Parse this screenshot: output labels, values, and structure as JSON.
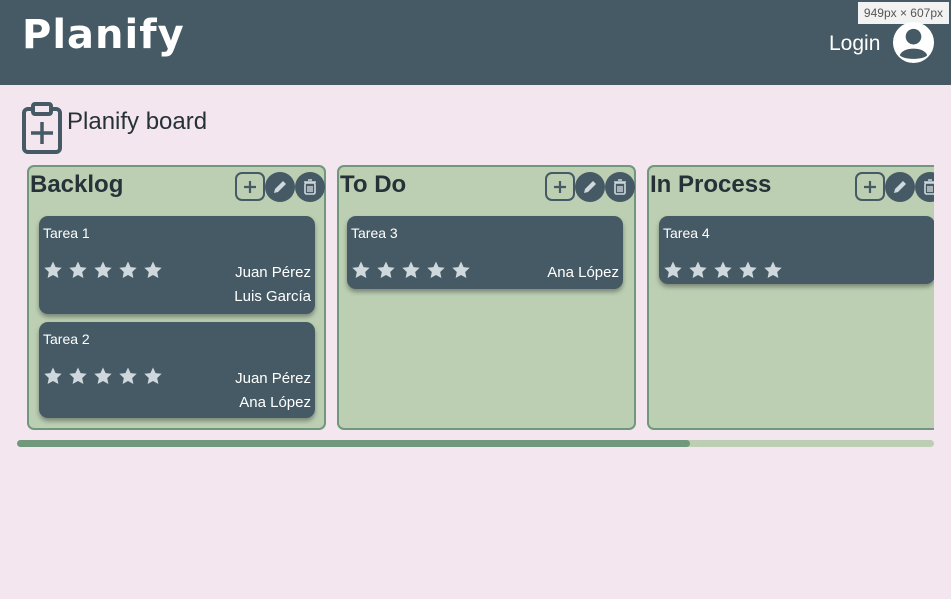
{
  "app": {
    "logo": "Planify",
    "viewport_badge": "949px × 607px"
  },
  "header": {
    "login_label": "Login"
  },
  "board": {
    "title": "Planify board"
  },
  "columns": [
    {
      "title": "Backlog",
      "cards": [
        {
          "title": "Tarea 1",
          "rating": 0,
          "max_rating": 5,
          "assignees": [
            "Juan Pérez",
            "Luis García"
          ]
        },
        {
          "title": "Tarea 2",
          "rating": 0,
          "max_rating": 5,
          "assignees": [
            "Juan Pérez",
            "Ana López"
          ]
        }
      ]
    },
    {
      "title": "To Do",
      "cards": [
        {
          "title": "Tarea 3",
          "rating": 0,
          "max_rating": 5,
          "assignees": [
            "Ana López"
          ]
        }
      ]
    },
    {
      "title": "In Process",
      "cards": [
        {
          "title": "Tarea 4",
          "rating": 0,
          "max_rating": 5,
          "assignees": []
        }
      ]
    }
  ],
  "icons": {
    "user": "user-circle-icon",
    "board": "clipboard-plus-icon",
    "add": "add-task-icon",
    "edit": "pencil-icon",
    "delete": "trash-icon",
    "star": "star-icon"
  },
  "colors": {
    "header": "#455a64",
    "page": "#f3e6ee",
    "column": "#bccfb3",
    "column_border": "#71977d",
    "card": "#455a64",
    "star": "#cfd8dc"
  },
  "scroll": {
    "horizontal_position": 0
  }
}
